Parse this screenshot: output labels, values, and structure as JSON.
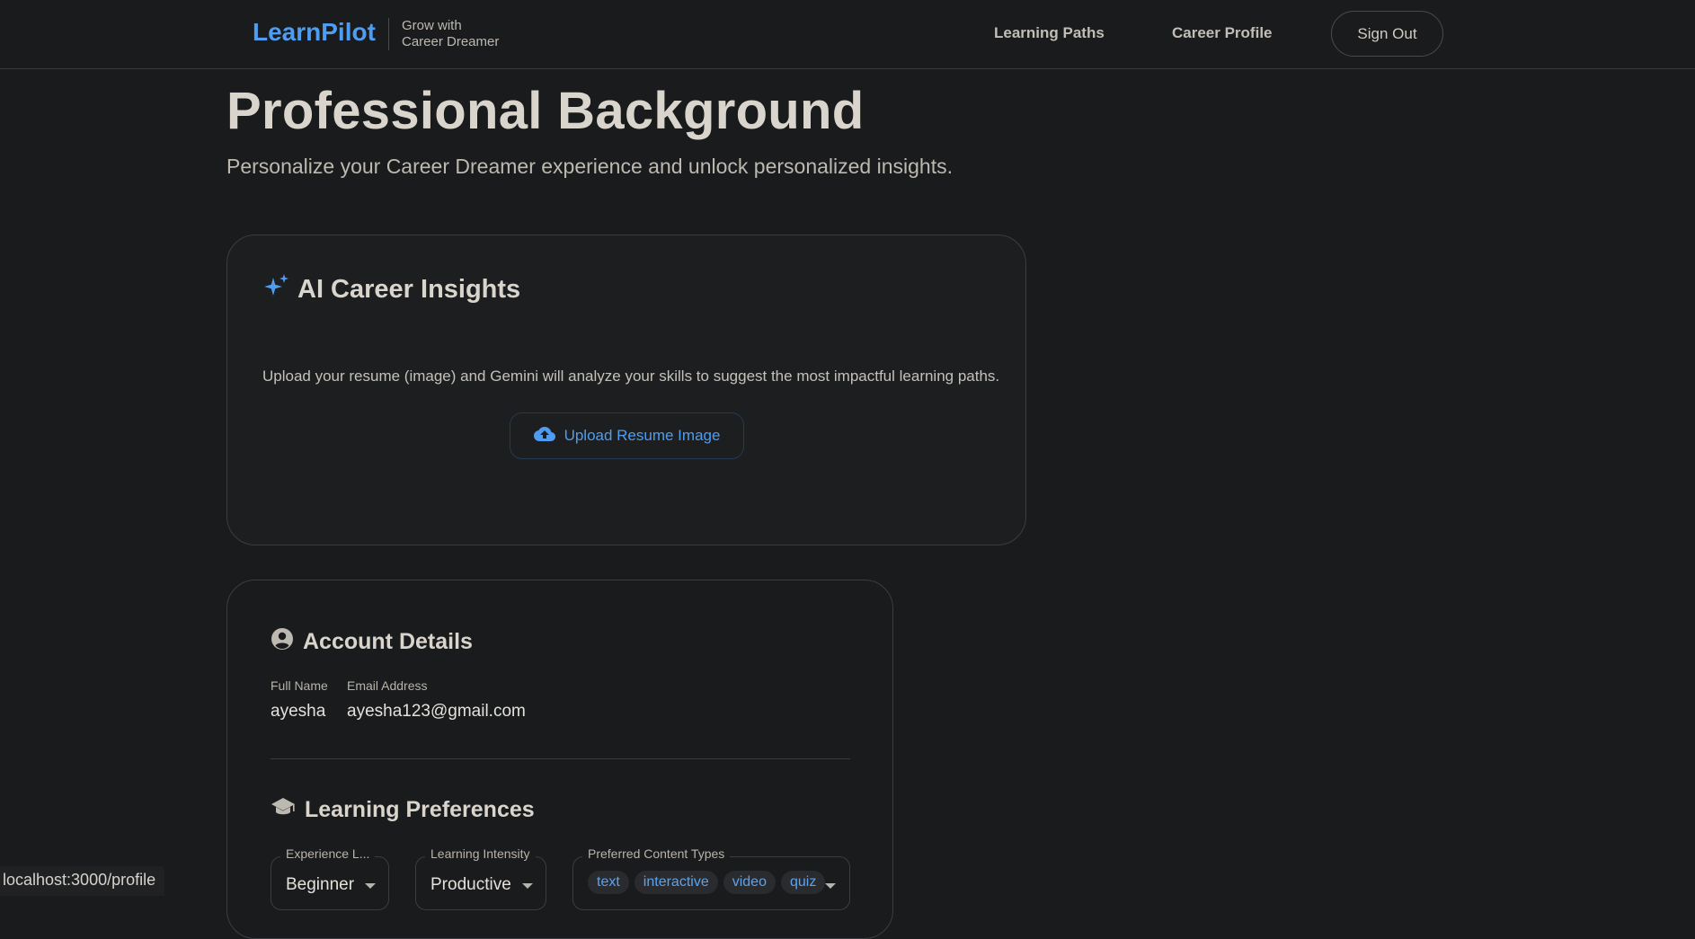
{
  "header": {
    "brand": "LearnPilot",
    "tagline_line1": "Grow with",
    "tagline_line2": "Career Dreamer",
    "nav": {
      "learning_paths": "Learning Paths",
      "career_profile": "Career Profile"
    },
    "sign_out": "Sign Out"
  },
  "page": {
    "title": "Professional Background",
    "subtitle": "Personalize your Career Dreamer experience and unlock personalized insights."
  },
  "ai_card": {
    "icon": "sparkles-icon",
    "title": "AI Career Insights",
    "description": "Upload your resume (image) and Gemini will analyze your skills to suggest the most impactful learning paths.",
    "upload_button": "Upload Resume Image",
    "upload_icon": "cloud-upload-icon"
  },
  "account": {
    "icon": "account-circle-icon",
    "title": "Account Details",
    "full_name_label": "Full Name",
    "full_name": "ayesha",
    "email_label": "Email Address",
    "email": "ayesha123@gmail.com"
  },
  "preferences": {
    "icon": "graduation-cap-icon",
    "title": "Learning Preferences",
    "experience_label": "Experience L...",
    "experience_value": "Beginner",
    "intensity_label": "Learning Intensity",
    "intensity_value": "Productive",
    "content_types_label": "Preferred Content Types",
    "content_types": [
      "text",
      "interactive",
      "video",
      "quiz"
    ]
  },
  "statusbar": {
    "url": "localhost:3000/profile"
  },
  "colors": {
    "accent": "#4f9df0",
    "background": "#1a1b1d",
    "border": "#3c3d40"
  }
}
